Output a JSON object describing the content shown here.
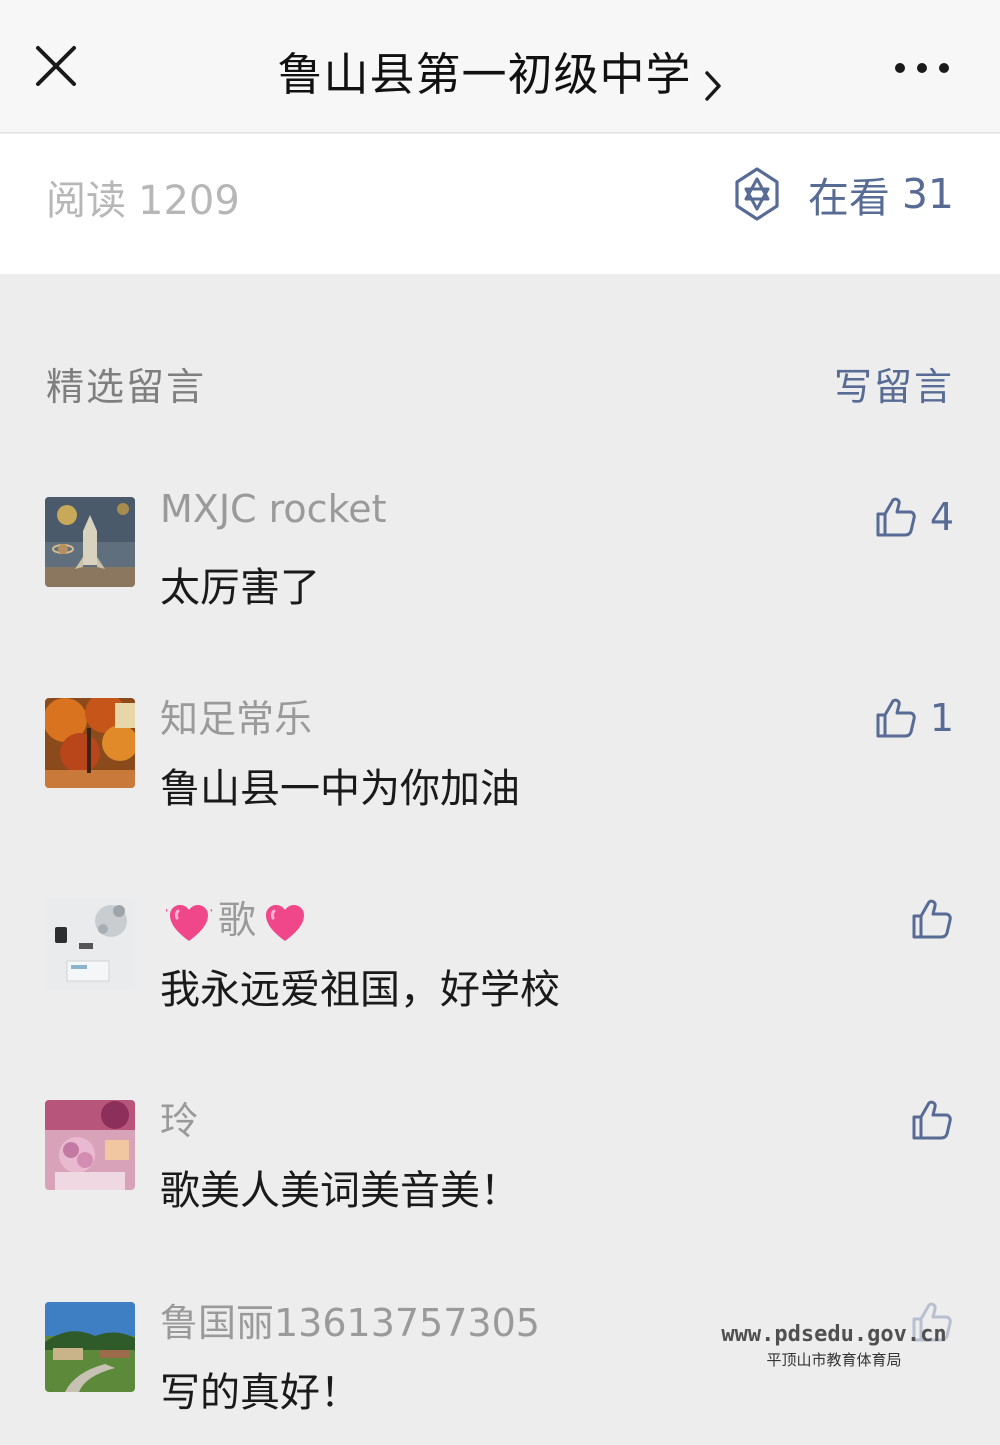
{
  "header": {
    "title": "鲁山县第一初级中学",
    "icons": {
      "close": "close-icon",
      "chevron": "chevron-right-icon",
      "more": "more-icon"
    }
  },
  "stats": {
    "read_label": "阅读",
    "read_count": "1209",
    "looking_label": "在看",
    "looking_count": "31"
  },
  "comments_section": {
    "title": "精选留言",
    "write_label": "写留言"
  },
  "comments": [
    {
      "nickname": "MXJC rocket",
      "text": "太厉害了",
      "likes": "4"
    },
    {
      "nickname": "知足常乐",
      "text": "鲁山县一中为你加油",
      "likes": "1"
    },
    {
      "nickname": "歌",
      "text": "我永远爱祖国，好学校",
      "likes": ""
    },
    {
      "nickname": "玲",
      "text": "歌美人美词美音美！",
      "likes": ""
    },
    {
      "nickname": "鲁国丽13613757305",
      "text": "写的真好！",
      "likes": ""
    }
  ],
  "watermark": {
    "url": "www.pdsedu.gov.cn",
    "org": "平顶山市教育体育局"
  },
  "colors": {
    "link": "#576b95",
    "background": "#ededed",
    "muted": "#b7b7b7"
  }
}
